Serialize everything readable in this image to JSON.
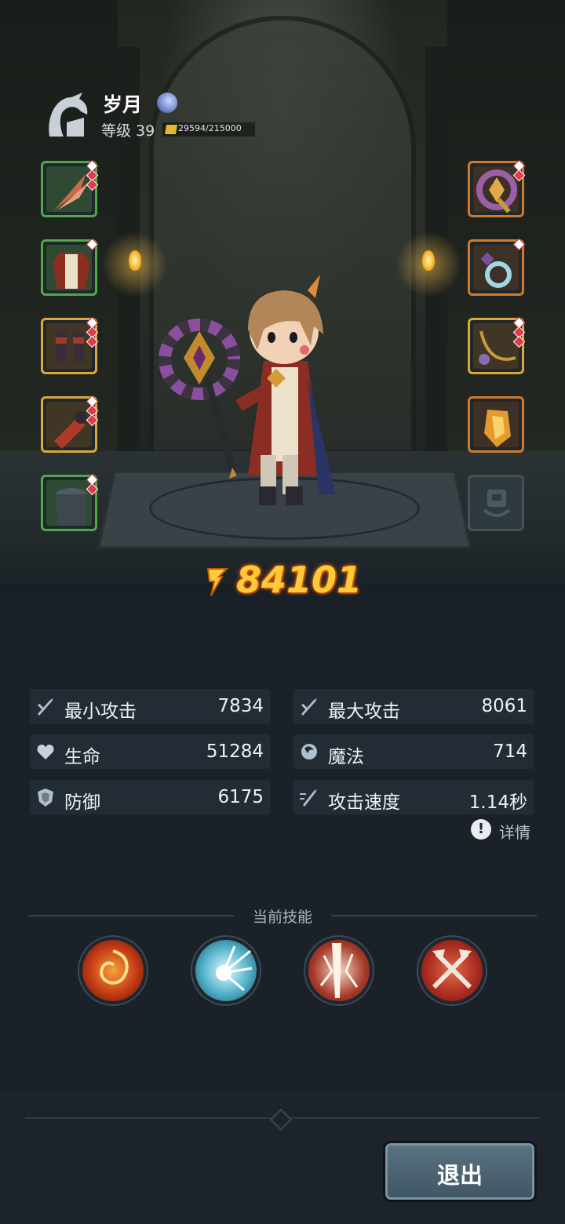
{
  "player": {
    "name": "岁月",
    "level_label": "等级 39",
    "exp_text": "29594/215000"
  },
  "equipment": {
    "left": [
      {
        "name": "feather-weapon",
        "rarity": "green"
      },
      {
        "name": "robe-armor",
        "rarity": "green"
      },
      {
        "name": "boots",
        "rarity": "gold"
      },
      {
        "name": "bracer",
        "rarity": "gold"
      },
      {
        "name": "hood",
        "rarity": "green"
      }
    ],
    "right": [
      {
        "name": "axe-staff",
        "rarity": "orange"
      },
      {
        "name": "ring",
        "rarity": "orange"
      },
      {
        "name": "necklace",
        "rarity": "gold"
      },
      {
        "name": "gauntlet",
        "rarity": "orange"
      },
      {
        "name": "empty-slot",
        "rarity": "empty"
      }
    ]
  },
  "power": "84101",
  "stats": [
    {
      "label": "最小攻击",
      "value": "7834",
      "icon": "sword-icon"
    },
    {
      "label": "最大攻击",
      "value": "8061",
      "icon": "sword-icon"
    },
    {
      "label": "生命",
      "value": "51284",
      "icon": "heart-icon"
    },
    {
      "label": "魔法",
      "value": "714",
      "icon": "magic-icon"
    },
    {
      "label": "防御",
      "value": "6175",
      "icon": "shield-icon"
    },
    {
      "label": "攻击速度",
      "value": "1.14秒",
      "icon": "speed-icon"
    }
  ],
  "detail_label": "详情",
  "skills_title": "当前技能",
  "skills": [
    "fire-vortex-skill",
    "light-burst-skill",
    "lightning-strike-skill",
    "crossed-axes-skill"
  ],
  "exit_label": "退出",
  "colors": {
    "power": "#ffc93c",
    "panel": "#232c35",
    "background": "#1a2129"
  }
}
